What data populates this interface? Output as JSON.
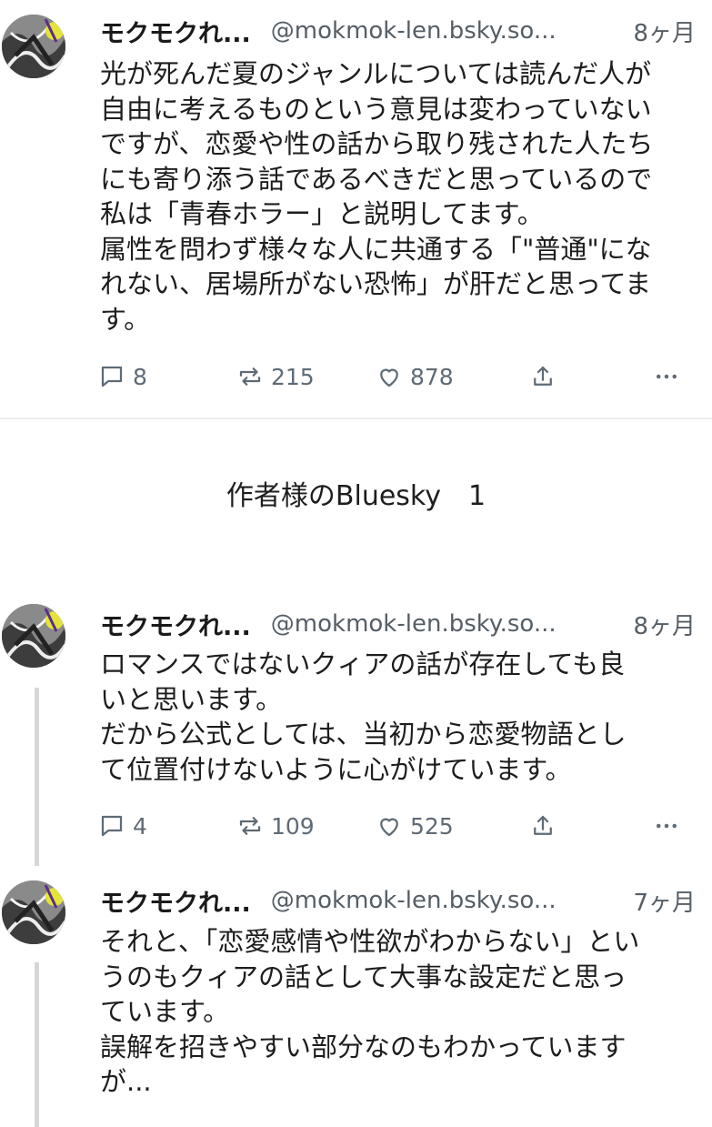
{
  "posts": [
    {
      "name": "モクモクれ...",
      "handle": "@mokmok-len.bsky.so...",
      "time": "8ヶ月",
      "text": "光が死んだ夏のジャンルについては読んだ人が\n自由に考えるものという意見は変わっていない\nですが、恋愛や性の話から取り残された人たち\nにも寄り添う話であるべきだと思っているので\n私は「青春ホラー」と説明してます。\n属性を問わず様々な人に共通する「\"普通\"にな\nれない、居場所がない恐怖」が肝だと思ってま\nす。",
      "replies": "8",
      "reposts": "215",
      "likes": "878"
    },
    {
      "name": "モクモクれ...",
      "handle": "@mokmok-len.bsky.so...",
      "time": "8ヶ月",
      "text": "ロマンスではないクィアの話が存在しても良\nいと思います。\nだから公式としては、当初から恋愛物語とし\nて位置付けないように心がけています。",
      "replies": "4",
      "reposts": "109",
      "likes": "525"
    },
    {
      "name": "モクモクれ...",
      "handle": "@mokmok-len.bsky.so...",
      "time": "7ヶ月",
      "text": "それと、「恋愛感情や性欲がわからない」とい\nうのもクィアの話として大事な設定だと思っ\nています。\n誤解を招きやすい部分なのもわかっています\nが..."
    }
  ],
  "section": {
    "title": "作者様のBluesky　1"
  },
  "icons": {
    "reply": "reply-bubble-icon",
    "repost": "repost-arrows-icon",
    "like": "heart-icon",
    "share": "share-upload-icon",
    "more": "more-dots-icon"
  },
  "colors": {
    "text": "#1d1d1d",
    "muted": "#5f6b75",
    "divider": "#ececec",
    "thread_line": "#d6d6d6"
  }
}
